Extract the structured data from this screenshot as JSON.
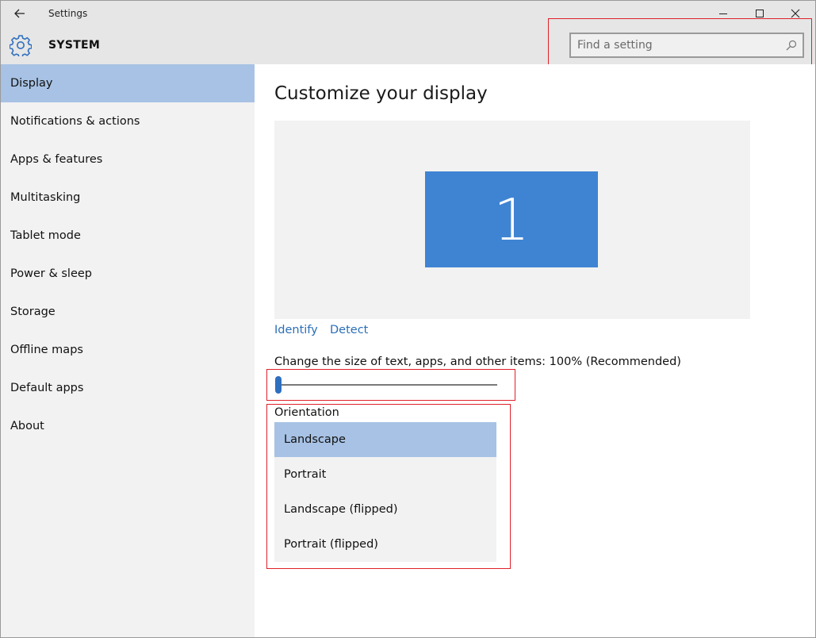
{
  "window": {
    "title": "Settings"
  },
  "header": {
    "section": "SYSTEM"
  },
  "search": {
    "placeholder": "Find a setting"
  },
  "sidebar": {
    "items": [
      {
        "label": "Display",
        "active": true
      },
      {
        "label": "Notifications & actions"
      },
      {
        "label": "Apps & features"
      },
      {
        "label": "Multitasking"
      },
      {
        "label": "Tablet mode"
      },
      {
        "label": "Power & sleep"
      },
      {
        "label": "Storage"
      },
      {
        "label": "Offline maps"
      },
      {
        "label": "Default apps"
      },
      {
        "label": "About"
      }
    ]
  },
  "main": {
    "title": "Customize your display",
    "monitor_number": "1",
    "identify_label": "Identify",
    "detect_label": "Detect",
    "scale_label": "Change the size of text, apps, and other items: 100% (Recommended)",
    "scale_value_fraction": 0.0,
    "orientation_label": "Orientation",
    "orientation_options": [
      "Landscape",
      "Portrait",
      "Landscape (flipped)",
      "Portrait (flipped)"
    ],
    "orientation_selected": "Landscape"
  },
  "colors": {
    "accent": "#3f84d3",
    "selection": "#a7c2e4",
    "link": "#2a6fb8",
    "highlight_border": "#e0202a"
  },
  "icons": {
    "back": "back-arrow-icon",
    "settings": "gear-icon",
    "search": "search-icon",
    "minimize": "minimize-icon",
    "maximize": "maximize-icon",
    "close": "close-icon"
  }
}
